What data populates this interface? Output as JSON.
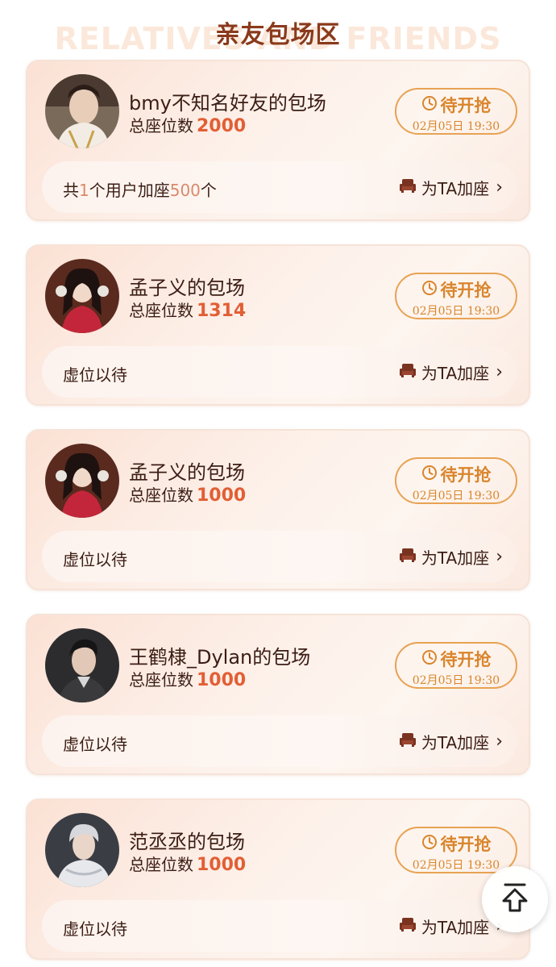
{
  "section": {
    "title": "亲友包场区",
    "subtitle": "RELATIVES AND FRIENDS"
  },
  "colors": {
    "accent": "#e8a253",
    "seat_number": "#e25f35",
    "title_brown": "#8a3a1c"
  },
  "cards": [
    {
      "avatar": "user-avatar-1",
      "title": "bmy不知名好友的包场",
      "seats_label": "总座位数",
      "seats_value": "2000",
      "status": "待开抢",
      "time": "02月05日 19:30",
      "bottom_pre": "共",
      "bottom_n1": "1",
      "bottom_mid": "个用户加座",
      "bottom_n2": "500",
      "bottom_post": "个",
      "add_seat": "为TA加座"
    },
    {
      "avatar": "user-avatar-2",
      "title": "孟子义的包场",
      "seats_label": "总座位数",
      "seats_value": "1314",
      "status": "待开抢",
      "time": "02月05日 19:30",
      "bottom": "虚位以待",
      "add_seat": "为TA加座"
    },
    {
      "avatar": "user-avatar-3",
      "title": "孟子义的包场",
      "seats_label": "总座位数",
      "seats_value": "1000",
      "status": "待开抢",
      "time": "02月05日 19:30",
      "bottom": "虚位以待",
      "add_seat": "为TA加座"
    },
    {
      "avatar": "user-avatar-4",
      "title": "王鹤棣_Dylan的包场",
      "seats_label": "总座位数",
      "seats_value": "1000",
      "status": "待开抢",
      "time": "02月05日 19:30",
      "bottom": "虚位以待",
      "add_seat": "为TA加座"
    },
    {
      "avatar": "user-avatar-5",
      "title": "范丞丞的包场",
      "seats_label": "总座位数",
      "seats_value": "1000",
      "status": "待开抢",
      "time": "02月05日 19:30",
      "bottom": "虚位以待",
      "add_seat": "为TA加座"
    }
  ],
  "scroll_top": {
    "icon": "scroll-to-top-icon"
  }
}
